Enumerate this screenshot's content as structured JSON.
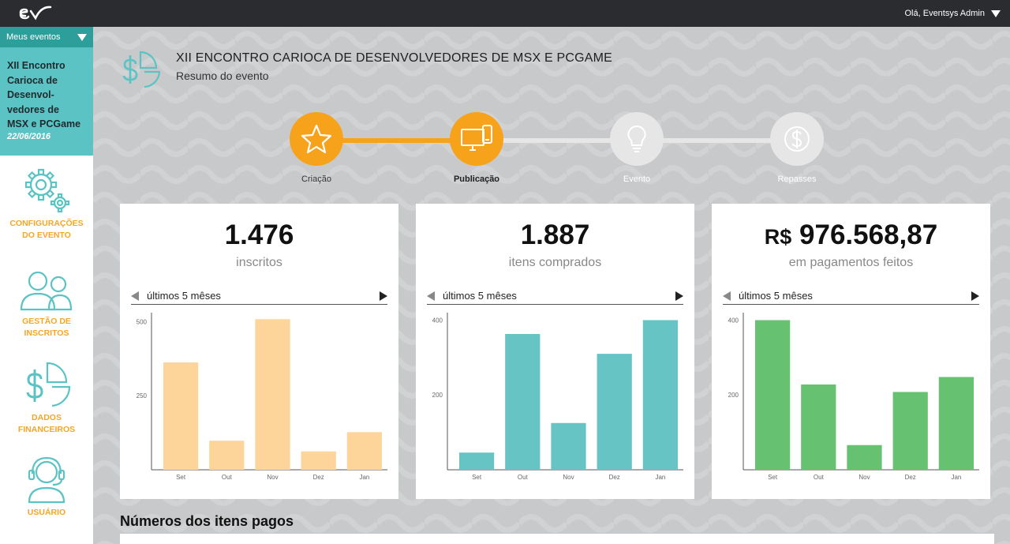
{
  "topbar": {
    "user_greeting": "Olá, Eventsys Admin"
  },
  "sidebar": {
    "events_dropdown_label": "Meus eventos",
    "event": {
      "name": "XII Encontro Carioca de Desenvol-vedores de MSX e PCGame",
      "date": "22/06/2016"
    },
    "nav": [
      {
        "label_line1": "CONFIGURAÇÕES",
        "label_line2": "DO EVENTO",
        "icon": "gears-icon"
      },
      {
        "label_line1": "GESTÃO DE",
        "label_line2": "INSCRITOS",
        "icon": "users-icon"
      },
      {
        "label_line1": "DADOS",
        "label_line2": "FINANCEIROS",
        "icon": "money-chart-icon"
      },
      {
        "label_line1": "USUÁRIO",
        "label_line2": "",
        "icon": "headset-user-icon"
      }
    ]
  },
  "header": {
    "title": "XII ENCONTRO CARIOCA DE DESENVOLVEDORES DE MSX E PCGAME",
    "subtitle": "Resumo do evento"
  },
  "stepper": {
    "steps": [
      {
        "label": "Criação",
        "state": "done"
      },
      {
        "label": "Publicação",
        "state": "current"
      },
      {
        "label": "Evento",
        "state": "pending"
      },
      {
        "label": "Repasses",
        "state": "pending"
      }
    ],
    "colors": {
      "active": "#f7a21b",
      "inactive": "#e6e6e7"
    }
  },
  "cards": [
    {
      "value": "1.476",
      "currency": "",
      "caption": "inscritos",
      "period": "últimos 5 mêses",
      "color": "#fdd49a"
    },
    {
      "value": "1.887",
      "currency": "",
      "caption": "itens comprados",
      "period": "últimos 5 mêses",
      "color": "#66c4c5"
    },
    {
      "value": "976.568,87",
      "currency": "R$",
      "caption": "em pagamentos feitos",
      "period": "últimos 5 mêses",
      "color": "#66c170"
    }
  ],
  "chart_data": [
    {
      "type": "bar",
      "categories": [
        "Set",
        "Out",
        "Nov",
        "Dez",
        "Jan"
      ],
      "values": [
        362,
        98,
        508,
        62,
        127
      ],
      "ylim": [
        0,
        530
      ],
      "yticks": [
        250,
        500
      ],
      "xlabel": "",
      "ylabel": "",
      "grid": false
    },
    {
      "type": "bar",
      "categories": [
        "Set",
        "Out",
        "Nov",
        "Dez",
        "Jan"
      ],
      "values": [
        46,
        363,
        125,
        310,
        400
      ],
      "ylim": [
        0,
        420
      ],
      "yticks": [
        200,
        400
      ],
      "xlabel": "",
      "ylabel": "",
      "grid": false
    },
    {
      "type": "bar",
      "categories": [
        "Set",
        "Out",
        "Nov",
        "Dez",
        "Jan"
      ],
      "values": [
        400,
        228,
        66,
        208,
        248
      ],
      "ylim": [
        0,
        420
      ],
      "yticks": [
        200,
        400
      ],
      "xlabel": "",
      "ylabel": "",
      "grid": false
    }
  ],
  "section": {
    "title": "Números dos itens pagos"
  }
}
